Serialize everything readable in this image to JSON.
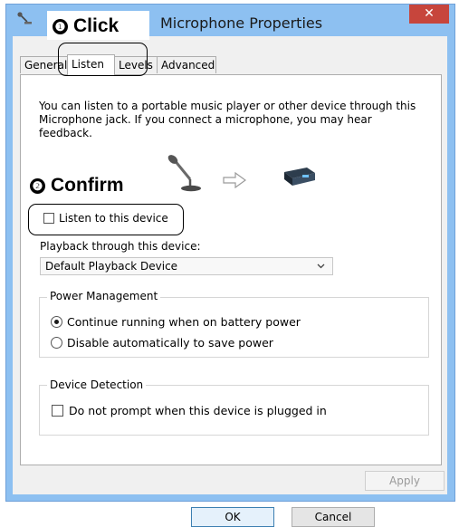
{
  "window": {
    "title": "Microphone Properties",
    "close_glyph": "✕"
  },
  "tabs": [
    {
      "label": "General"
    },
    {
      "label": "Listen"
    },
    {
      "label": "Levels"
    },
    {
      "label": "Advanced"
    }
  ],
  "listen": {
    "description": "You can listen to a portable music player or other device through this Microphone jack.  If you connect a microphone, you may hear feedback.",
    "listen_checkbox_label": "Listen to this device",
    "listen_checked": false,
    "playback_label": "Playback through this device:",
    "playback_value": "Default Playback Device",
    "power": {
      "group_label": "Power Management",
      "option_continue": "Continue running when on battery power",
      "option_disable": "Disable automatically to save power",
      "selected": "continue"
    },
    "detection": {
      "group_label": "Device Detection",
      "checkbox_label": "Do not prompt when this device is plugged in",
      "checked": false
    }
  },
  "annotations": {
    "step1_number": "❶",
    "step1_label": "Click",
    "step2_number": "❷",
    "step2_label": "Confirm"
  },
  "buttons": {
    "ok": "OK",
    "cancel": "Cancel",
    "apply": "Apply"
  },
  "icons": {
    "title_icon": "microphone-icon",
    "mic": "microphone-stand-icon",
    "arrow": "right-arrow-icon",
    "device": "playback-device-icon"
  },
  "colors": {
    "titlebar": "#8dc0f1",
    "close": "#c7453c"
  }
}
